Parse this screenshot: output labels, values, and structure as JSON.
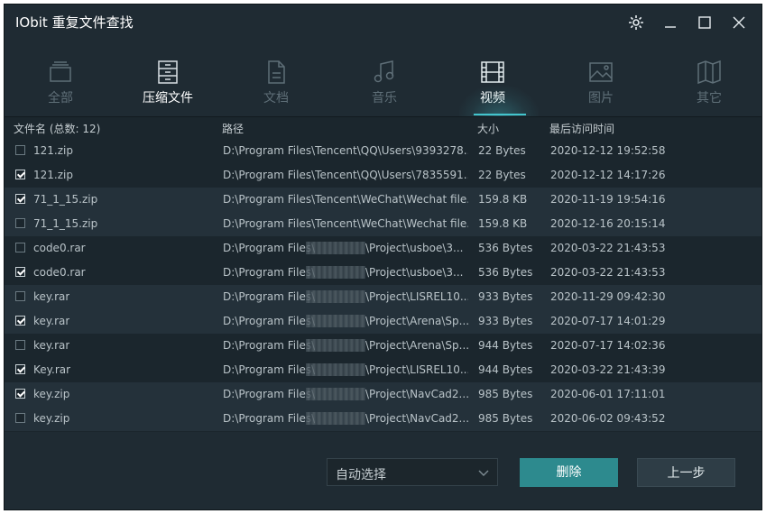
{
  "window": {
    "title": "IObit 重复文件查找",
    "controls": [
      "gear-icon",
      "minimize-icon",
      "maximize-icon",
      "close-icon"
    ]
  },
  "nav": {
    "items": [
      {
        "label": "全部",
        "icon": "folders-icon",
        "state": "dim"
      },
      {
        "label": "压缩文件",
        "icon": "archive-icon",
        "state": "on"
      },
      {
        "label": "文档",
        "icon": "document-icon",
        "state": "dim"
      },
      {
        "label": "音乐",
        "icon": "music-icon",
        "state": "dim"
      },
      {
        "label": "视频",
        "icon": "film-icon",
        "state": "active"
      },
      {
        "label": "图片",
        "icon": "image-icon",
        "state": "dim"
      },
      {
        "label": "其它",
        "icon": "map-icon",
        "state": "dim"
      }
    ]
  },
  "table": {
    "headers": {
      "name": "文件名 (总数: 12)",
      "path": "路径",
      "size": "大小",
      "time": "最后访问时间"
    },
    "rows": [
      {
        "checked": false,
        "name": "121.zip",
        "path": "D:\\Program Files\\Tencent\\QQ\\Users\\9393278...",
        "size": "22 Bytes",
        "time": "2020-12-12 19:52:58"
      },
      {
        "checked": true,
        "name": "121.zip",
        "path": "D:\\Program Files\\Tencent\\QQ\\Users\\7835591...",
        "size": "22 Bytes",
        "time": "2020-12-12 14:17:26"
      },
      {
        "checked": true,
        "name": "71_1_15.zip",
        "path": "D:\\Program Files\\Tencent\\WeChat\\Wechat file...",
        "size": "159.8 KB",
        "time": "2020-11-19 19:54:16"
      },
      {
        "checked": false,
        "name": "71_1_15.zip",
        "path": "D:\\Program Files\\Tencent\\WeChat\\Wechat file...",
        "size": "159.8 KB",
        "time": "2020-12-16 20:15:14"
      },
      {
        "checked": false,
        "name": "code0.rar",
        "path_a": "D:\\Program Files\\",
        "path_b": "\\Project\\usboe\\3...",
        "size": "536 Bytes",
        "time": "2020-03-22 21:43:53"
      },
      {
        "checked": true,
        "name": "code0.rar",
        "path_a": "D:\\Program Files\\",
        "path_b": "\\Project\\usboe\\3...",
        "size": "536 Bytes",
        "time": "2020-03-22 21:43:53"
      },
      {
        "checked": false,
        "name": "key.rar",
        "path_a": "D:\\Program Files\\",
        "path_b": "\\Project\\LISREL10...",
        "size": "933 Bytes",
        "time": "2020-11-29 09:42:30"
      },
      {
        "checked": true,
        "name": "key.rar",
        "path_a": "D:\\Program Files\\",
        "path_b": "\\Project\\Arena\\Sp...",
        "size": "933 Bytes",
        "time": "2020-07-17 14:01:29"
      },
      {
        "checked": false,
        "name": "key.rar",
        "path_a": "D:\\Program Files\\",
        "path_b": "\\Project\\Arena\\Sp...",
        "size": "944 Bytes",
        "time": "2020-07-17 14:02:36"
      },
      {
        "checked": true,
        "name": "Key.rar",
        "path_a": "D:\\Program Files\\",
        "path_b": "\\Project\\LISREL10...",
        "size": "944 Bytes",
        "time": "2020-03-22 21:43:39"
      },
      {
        "checked": true,
        "name": "key.zip",
        "path_a": "D:\\Program Files\\",
        "path_b": "\\Project\\NavCad2...",
        "size": "985 Bytes",
        "time": "2020-06-01 17:11:01"
      },
      {
        "checked": false,
        "name": "key.zip",
        "path_a": "D:\\Program Files\\",
        "path_b": "\\Project\\NavCad2...",
        "size": "985 Bytes",
        "time": "2020-06-02 09:43:52"
      }
    ]
  },
  "footer": {
    "select_value": "自动选择",
    "delete_label": "删除",
    "back_label": "上一步"
  },
  "colors": {
    "background": "#1f2b33",
    "accent": "#43c4cc",
    "primary_button": "#2d8a8e"
  }
}
